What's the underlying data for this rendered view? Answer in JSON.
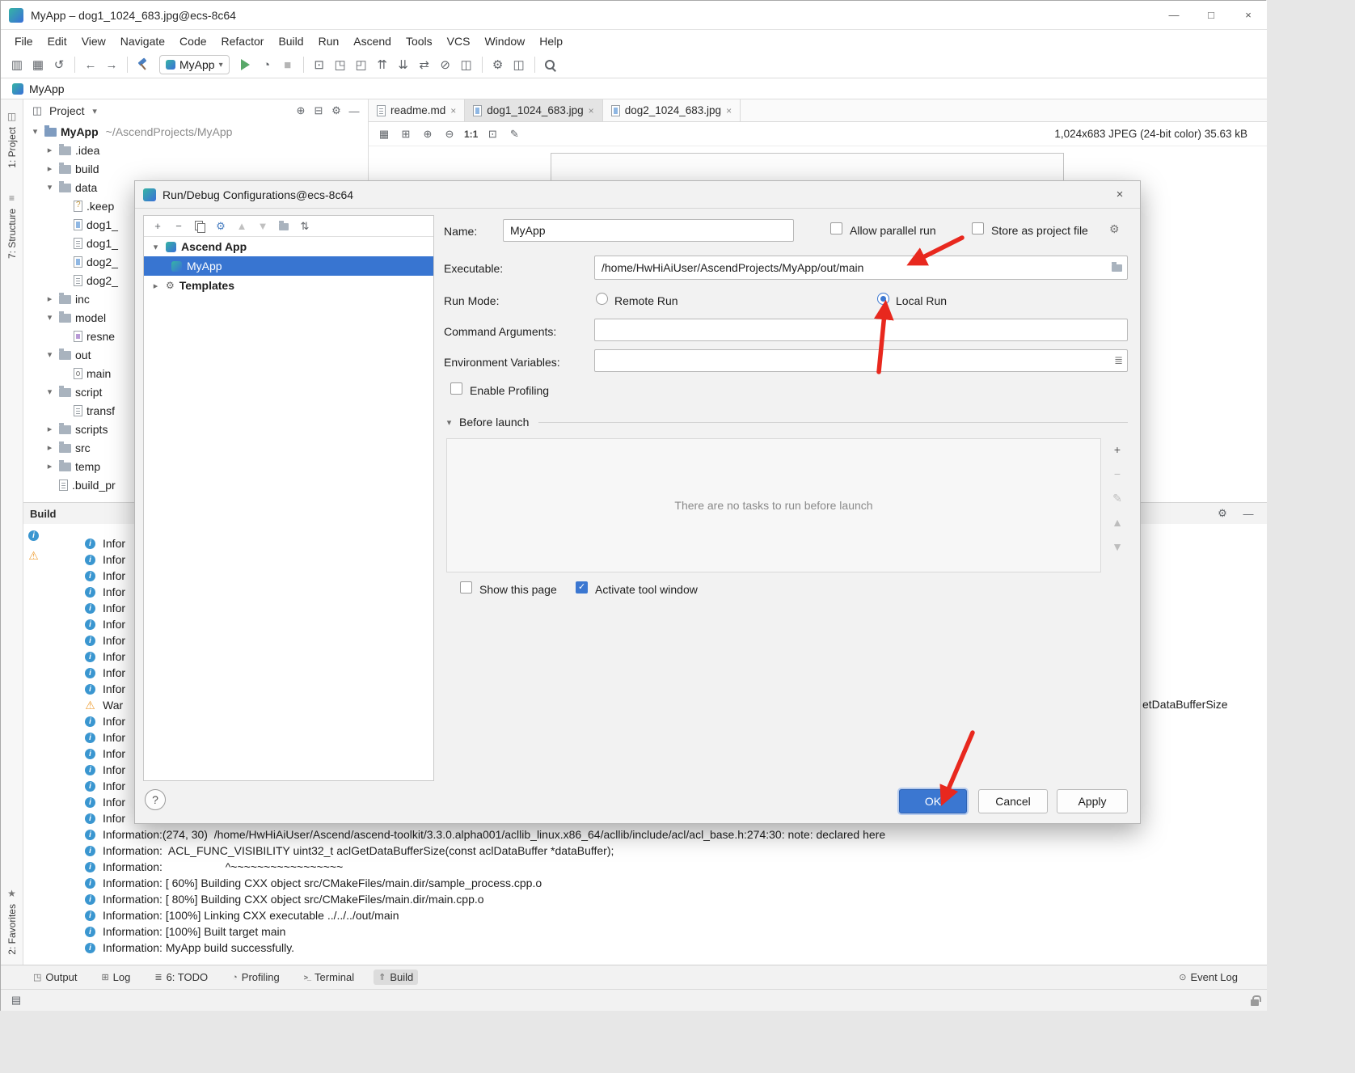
{
  "colors": {
    "accent": "#3b77d1",
    "selection_blue": "#3875d1",
    "arrow_red": "#e8281e",
    "info_blue": "#3a96d0",
    "warning_orange": "#efa13a",
    "run_green": "#59a869"
  },
  "window": {
    "title": "MyApp – dog1_1024_683.jpg@ecs-8c64"
  },
  "menubar": {
    "items": [
      "File",
      "Edit",
      "View",
      "Navigate",
      "Code",
      "Refactor",
      "Build",
      "Run",
      "Ascend",
      "Tools",
      "VCS",
      "Window",
      "Help"
    ]
  },
  "toolbar": {
    "run_config_value": "MyApp"
  },
  "navbar": {
    "project": "MyApp"
  },
  "left_stripe": {
    "project_label": "1: Project",
    "structure_label": "7: Structure",
    "favorites_label": "2: Favorites"
  },
  "project_panel": {
    "header": "Project",
    "root": {
      "name": "MyApp",
      "path": "~/AscendProjects/MyApp"
    },
    "items": [
      {
        "label": ".idea",
        "indent": 1,
        "chevron": "collapsed",
        "icon": "folder-icon"
      },
      {
        "label": "build",
        "indent": 1,
        "chevron": "collapsed",
        "icon": "folder-icon"
      },
      {
        "label": "data",
        "indent": 1,
        "chevron": "expanded",
        "icon": "folder-icon"
      },
      {
        "label": ".keep",
        "indent": 2,
        "chevron": "none",
        "icon": "file-unknown-icon"
      },
      {
        "label": "dog1_",
        "indent": 2,
        "chevron": "none",
        "icon": "file-image-icon"
      },
      {
        "label": "dog1_",
        "indent": 2,
        "chevron": "none",
        "icon": "file-text-icon"
      },
      {
        "label": "dog2_",
        "indent": 2,
        "chevron": "none",
        "icon": "file-image-icon"
      },
      {
        "label": "dog2_",
        "indent": 2,
        "chevron": "none",
        "icon": "file-text-icon"
      },
      {
        "label": "inc",
        "indent": 1,
        "chevron": "collapsed",
        "icon": "folder-icon"
      },
      {
        "label": "model",
        "indent": 1,
        "chevron": "expanded",
        "icon": "folder-icon"
      },
      {
        "label": "resne",
        "indent": 2,
        "chevron": "none",
        "icon": "file-model-icon"
      },
      {
        "label": "out",
        "indent": 1,
        "chevron": "expanded",
        "icon": "folder-icon"
      },
      {
        "label": "main",
        "indent": 2,
        "chevron": "none",
        "icon": "file-exec-icon"
      },
      {
        "label": "script",
        "indent": 1,
        "chevron": "expanded",
        "icon": "folder-icon"
      },
      {
        "label": "transf",
        "indent": 2,
        "chevron": "none",
        "icon": "file-text-icon"
      },
      {
        "label": "scripts",
        "indent": 1,
        "chevron": "collapsed",
        "icon": "folder-icon"
      },
      {
        "label": "src",
        "indent": 1,
        "chevron": "collapsed",
        "icon": "folder-icon"
      },
      {
        "label": "temp",
        "indent": 1,
        "chevron": "collapsed",
        "icon": "folder-icon"
      },
      {
        "label": ".build_pr",
        "indent": 1,
        "chevron": "none",
        "icon": "file-text-icon"
      }
    ]
  },
  "editor": {
    "tabs": [
      {
        "label": "readme.md",
        "active": false
      },
      {
        "label": "dog1_1024_683.jpg",
        "active": true
      },
      {
        "label": "dog2_1024_683.jpg",
        "active": false
      }
    ],
    "zoom_label": "1:1",
    "image_info": "1,024x683 JPEG (24-bit color) 35.63 kB"
  },
  "dialog": {
    "title": "Run/Debug Configurations@ecs-8c64",
    "tree": {
      "items": [
        {
          "label": "Ascend App"
        },
        {
          "label": "MyApp",
          "selected": true
        },
        {
          "label": "Templates"
        }
      ]
    },
    "form": {
      "name_label": "Name:",
      "name_value": "MyApp",
      "allow_parallel_run_label": "Allow parallel run",
      "store_as_project_file_label": "Store as project file",
      "executable_label": "Executable:",
      "executable_value": "/home/HwHiAiUser/AscendProjects/MyApp/out/main",
      "run_mode_label": "Run Mode:",
      "remote_run_label": "Remote Run",
      "local_run_label": "Local Run",
      "command_arguments_label": "Command Arguments:",
      "command_arguments_value": "",
      "environment_variables_label": "Environment Variables:",
      "environment_variables_value": "",
      "enable_profiling_label": "Enable Profiling",
      "before_launch_label": "Before launch",
      "no_tasks_text": "There are no tasks to run before launch",
      "show_this_page_label": "Show this page",
      "activate_tool_window_label": "Activate tool window"
    },
    "buttons": {
      "ok": "OK",
      "cancel": "Cancel",
      "apply": "Apply"
    }
  },
  "build_panel": {
    "title": "Build",
    "clipped_lines": [
      {
        "icon": "info-icon",
        "text": "Infor"
      },
      {
        "icon": "info-icon",
        "text": "Infor"
      },
      {
        "icon": "info-icon",
        "text": "Infor"
      },
      {
        "icon": "info-icon",
        "text": "Infor"
      },
      {
        "icon": "info-icon",
        "text": "Infor"
      },
      {
        "icon": "info-icon",
        "text": "Infor"
      },
      {
        "icon": "info-icon",
        "text": "Infor"
      },
      {
        "icon": "info-icon",
        "text": "Infor"
      },
      {
        "icon": "info-icon",
        "text": "Infor"
      },
      {
        "icon": "info-icon",
        "text": "Infor"
      },
      {
        "icon": "warning-icon",
        "text": "War"
      },
      {
        "icon": "info-icon",
        "text": "Infor"
      },
      {
        "icon": "info-icon",
        "text": "Infor"
      },
      {
        "icon": "info-icon",
        "text": "Infor"
      },
      {
        "icon": "info-icon",
        "text": "Infor"
      },
      {
        "icon": "info-icon",
        "text": "Infor"
      },
      {
        "icon": "info-icon",
        "text": "Infor"
      },
      {
        "icon": "info-icon",
        "text": "Infor"
      }
    ],
    "clipped_right_text": "etDataBufferSize",
    "messages": [
      "Information:(274, 30)  /home/HwHiAiUser/Ascend/ascend-toolkit/3.3.0.alpha001/acllib_linux.x86_64/acllib/include/acl/acl_base.h:274:30: note: declared here",
      "Information:  ACL_FUNC_VISIBILITY uint32_t aclGetDataBufferSize(const aclDataBuffer *dataBuffer);",
      "Information:                    ^~~~~~~~~~~~~~~~~~",
      "Information: [ 60%] Building CXX object src/CMakeFiles/main.dir/sample_process.cpp.o",
      "Information: [ 80%] Building CXX object src/CMakeFiles/main.dir/main.cpp.o",
      "Information: [100%] Linking CXX executable ../../../out/main",
      "Information: [100%] Built target main",
      "Information: MyApp build successfully."
    ]
  },
  "bottom_bar": {
    "left_items": [
      {
        "icon": "output-icon",
        "label": "Output"
      },
      {
        "icon": "log-icon",
        "label": "Log"
      },
      {
        "icon": "todo-icon",
        "label": "6: TODO"
      },
      {
        "icon": "profiling-icon",
        "label": "Profiling"
      },
      {
        "icon": "terminal-icon",
        "label": "Terminal"
      },
      {
        "icon": "build-tw-icon",
        "label": "Build",
        "active": true
      }
    ],
    "event_log_label": "Event Log"
  }
}
